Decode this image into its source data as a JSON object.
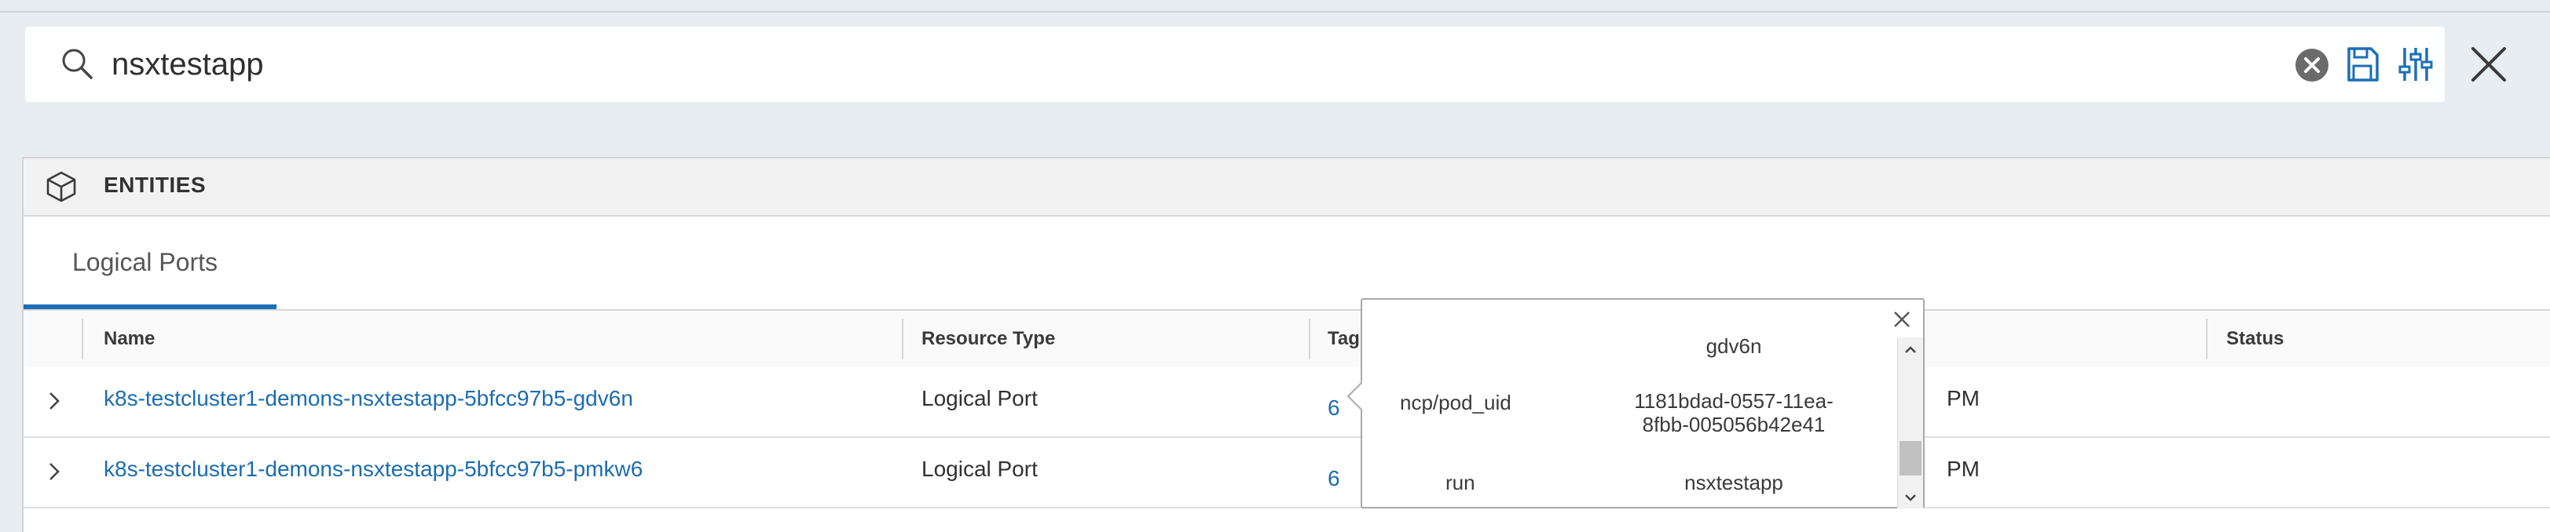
{
  "search": {
    "query": "nsxtestapp",
    "icons": {
      "search": "search-icon",
      "clear": "clear-circle-icon",
      "save": "save-disk-icon",
      "filter": "sliders-icon",
      "close": "close-icon"
    }
  },
  "entities": {
    "title": "ENTITIES",
    "icon": "cube-icon",
    "tabs": [
      {
        "label": "Logical Ports",
        "active": true
      }
    ]
  },
  "table": {
    "columns": [
      "Name",
      "Resource Type",
      "Tag",
      "Status"
    ],
    "rows": [
      {
        "name": "k8s-testcluster1-demons-nsxtestapp-5bfcc97b5-gdv6n",
        "resource_type": "Logical Port",
        "tags": "6",
        "time_fragment": "PM"
      },
      {
        "name": "k8s-testcluster1-demons-nsxtestapp-5bfcc97b5-pmkw6",
        "resource_type": "Logical Port",
        "tags": "6",
        "time_fragment": "PM"
      }
    ]
  },
  "tag_popover": {
    "entries": [
      {
        "key": "",
        "value": "gdv6n"
      },
      {
        "key": "ncp/pod_uid",
        "value": "1181bdad-0557-11ea-8fbb-005056b42e41"
      },
      {
        "key": "run",
        "value": "nsxtestapp"
      }
    ]
  },
  "colors": {
    "accent": "#1b6fb5",
    "link": "#1d6cb0",
    "background": "#e8edf1"
  }
}
